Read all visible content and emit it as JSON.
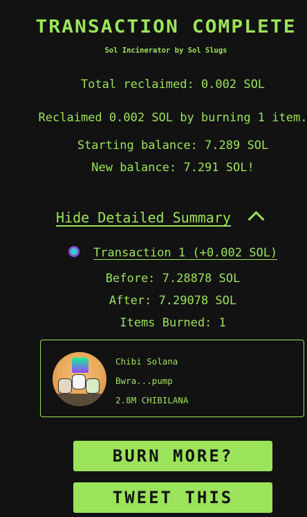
{
  "header": {
    "title": "TRANSACTION COMPLETE",
    "subtitle": "Sol Incinerator by Sol Slugs"
  },
  "summary": {
    "total_reclaimed": "Total reclaimed: 0.002 SOL",
    "reclaimed_line": "Reclaimed 0.002 SOL by burning 1 item.",
    "starting_balance": "Starting balance: 7.289 SOL",
    "new_balance": "New balance: 7.291 SOL!"
  },
  "details_toggle": {
    "label": "Hide Detailed Summary"
  },
  "transaction": {
    "link": "Transaction 1 (+0.002 SOL)",
    "before": "Before: 7.28878 SOL",
    "after": "After: 7.29078 SOL",
    "items_burned": "Items Burned: 1"
  },
  "token_card": {
    "name": "Chibi Solana",
    "address": "Bwra...pump",
    "amount": "2.8M CHIBILANA"
  },
  "buttons": {
    "burn_more": "BURN MORE?",
    "tweet": "TWEET THIS"
  },
  "colors": {
    "accent": "#9be35a",
    "background": "#121212"
  }
}
